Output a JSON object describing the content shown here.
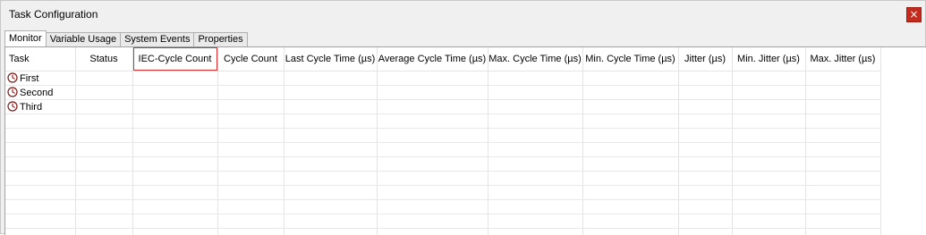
{
  "window": {
    "title": "Task Configuration",
    "close_glyph": "×",
    "close_color": "#c42b1c"
  },
  "tabs": [
    {
      "label": "Monitor",
      "active": true
    },
    {
      "label": "Variable Usage",
      "active": false
    },
    {
      "label": "System Events",
      "active": false
    },
    {
      "label": "Properties",
      "active": false
    }
  ],
  "table": {
    "columns": [
      "Task",
      "Status",
      "IEC-Cycle Count",
      "Cycle Count",
      "Last Cycle Time (µs)",
      "Average Cycle Time (µs)",
      "Max. Cycle Time (µs)",
      "Min. Cycle Time (µs)",
      "Jitter (µs)",
      "Min. Jitter (µs)",
      "Max. Jitter (µs)"
    ],
    "highlighted_column": "IEC-Cycle Count",
    "highlight_color": "#d93030",
    "rows": [
      {
        "task": "First",
        "icon": "clock-icon"
      },
      {
        "task": "Second",
        "icon": "clock-icon"
      },
      {
        "task": "Third",
        "icon": "clock-icon"
      }
    ]
  }
}
